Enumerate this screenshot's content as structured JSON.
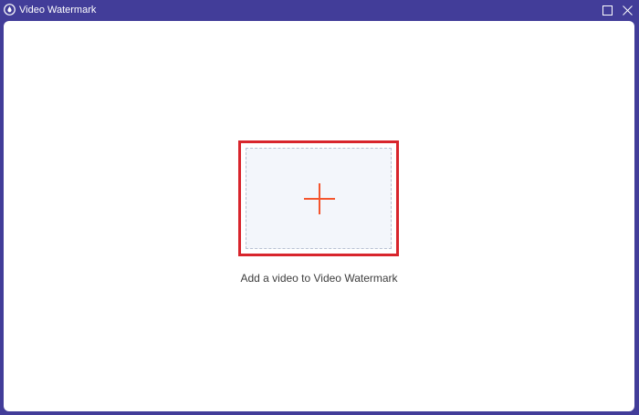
{
  "window": {
    "title": "Video Watermark",
    "icons": {
      "app": "water-drop-icon",
      "maximize": "maximize-icon",
      "close": "close-icon"
    }
  },
  "main": {
    "add_video_label": "Add a video to Video Watermark",
    "drop_zone_icon": "plus-icon"
  },
  "colors": {
    "titlebar_bg": "#423d99",
    "content_bg": "#ffffff",
    "highlight_border": "#d8252c",
    "plus_accent": "#f4552d",
    "drop_zone_bg": "#f3f6fb"
  }
}
